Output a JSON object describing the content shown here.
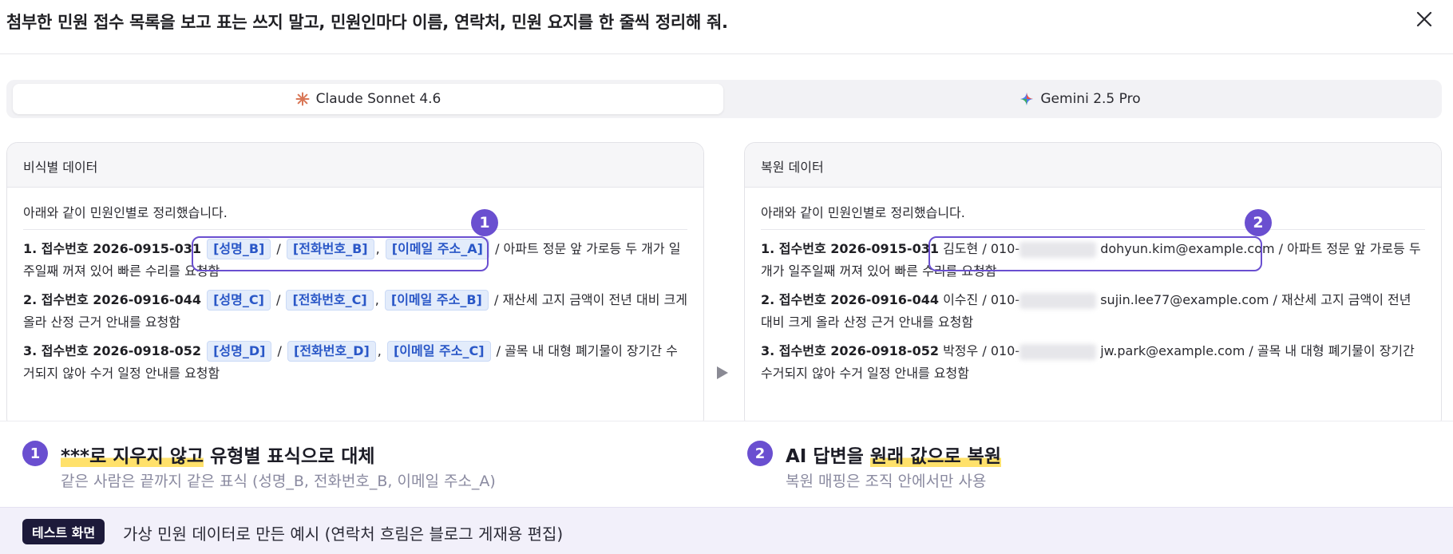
{
  "prompt": "첨부한 민원 접수 목록을 보고 표는 쓰지 말고, 민원인마다 이름, 연락처, 민원 요지를 한 줄씩 정리해 줘.",
  "close_icon": "close-icon",
  "models": [
    {
      "label": "Claude Sonnet 4.6",
      "icon": "claude-sparkle-icon",
      "color": "#d97757",
      "active": true
    },
    {
      "label": "Gemini 2.5 Pro",
      "icon": "gemini-star-icon",
      "color": "#4f7cf0",
      "active": false
    }
  ],
  "left_panel": {
    "title": "비식별 데이터",
    "intro": "아래와 같이 민원인별로 정리했습니다.",
    "items": [
      {
        "prefix": "1. 접수번호 2026-0915-031",
        "name": "[성명_B]",
        "phone": "[전화번호_B]",
        "email": "[이메일 주소_A]",
        "summary": "/ 아파트 정문 앞 가로등 두 개가 일주일째 꺼져 있어 빠른 수리를 요청함"
      },
      {
        "prefix": "2. 접수번호 2026-0916-044",
        "name": "[성명_C]",
        "phone": "[전화번호_C]",
        "email": "[이메일 주소_B]",
        "summary": "/ 재산세 고지 금액이 전년 대비 크게 올라 산정 근거 안내를 요청함"
      },
      {
        "prefix": "3. 접수번호 2026-0918-052",
        "name": "[성명_D]",
        "phone": "[전화번호_D]",
        "email": "[이메일 주소_C]",
        "summary": "/ 골목 내 대형 폐기물이 장기간 수거되지 않아 수거 일정 안내를 요청함"
      }
    ]
  },
  "right_panel": {
    "title": "복원 데이터",
    "intro": "아래와 같이 민원인별로 정리했습니다.",
    "items": [
      {
        "prefix": "1. 접수번호 2026-0915-031",
        "name": "김도현",
        "phone_prefix": "010-",
        "email": "dohyun.kim@example.com",
        "summary": "/ 아파트 정문 앞 가로등 두 개가 일주일째 꺼져 있어 빠른 수리를 요청함"
      },
      {
        "prefix": "2. 접수번호 2026-0916-044",
        "name": "이수진",
        "phone_prefix": "010-",
        "email": "sujin.lee77@example.com",
        "summary": "/ 재산세 고지 금액이 전년 대비 크게 올라 산정 근거 안내를 요청함"
      },
      {
        "prefix": "3. 접수번호 2026-0918-052",
        "name": "박정우",
        "phone_prefix": "010-",
        "email": "jw.park@example.com",
        "summary": "/ 골목 내 대형 폐기물이 장기간 수거되지 않아 수거 일정 안내를 요청함"
      }
    ]
  },
  "callouts": [
    {
      "number": "1",
      "title_mark": "***로 지우지 않고",
      "title_rest": " 유형별 표식으로 대체",
      "sub": "같은 사람은 끝까지 같은 표식 (성명_B, 전화번호_B, 이메일 주소_A)"
    },
    {
      "number": "2",
      "title_plain": "AI 답변을 ",
      "title_mark": "원래 값으로 복원",
      "sub": "복원 매핑은 조직 안에서만 사용"
    }
  ],
  "footer": {
    "tag": "테스트 화면",
    "text": "가상 민원 데이터로 만든 예시 (연락처 흐림은 블로그 게재용 편집)"
  },
  "colors": {
    "accent": "#6a4fd0",
    "chip_bg": "#e3ecfb",
    "chip_text": "#2a57c7",
    "highlight": "#ffe16b"
  }
}
